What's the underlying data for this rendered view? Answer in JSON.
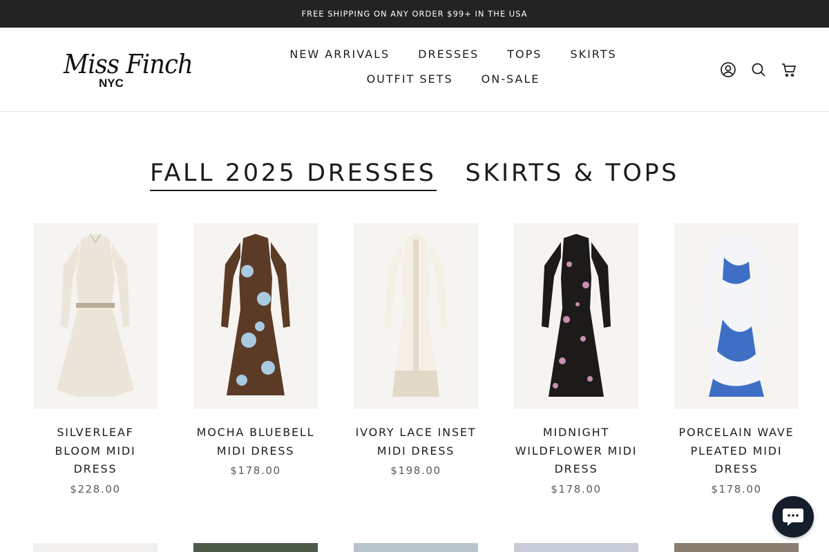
{
  "announcement": "FREE SHIPPING ON ANY ORDER $99+ IN THE USA",
  "brand": {
    "script": "Miss Finch",
    "sub": "NYC"
  },
  "nav": [
    "NEW ARRIVALS",
    "DRESSES",
    "TOPS",
    "SKIRTS",
    "OUTFIT SETS",
    "ON-SALE"
  ],
  "header_icons": [
    "account-icon",
    "search-icon",
    "cart-icon"
  ],
  "tabs": [
    {
      "label": "FALL 2025 DRESSES",
      "active": true
    },
    {
      "label": "SKIRTS & TOPS",
      "active": false
    }
  ],
  "products": [
    {
      "title": "SILVERLEAF BLOOM MIDI DRESS",
      "price": "$228.00",
      "colors": [
        "#ece5da",
        "#b7ab97"
      ]
    },
    {
      "title": "MOCHA BLUEBELL MIDI DRESS",
      "price": "$178.00",
      "colors": [
        "#5b3b26",
        "#a8cbe2"
      ]
    },
    {
      "title": "IVORY LACE INSET MIDI DRESS",
      "price": "$198.00",
      "colors": [
        "#f5f0e6",
        "#e2d9c8"
      ]
    },
    {
      "title": "MIDNIGHT WILDFLOWER MIDI DRESS",
      "price": "$178.00",
      "colors": [
        "#1d1b1a",
        "#c98fb2"
      ]
    },
    {
      "title": "PORCELAIN WAVE PLEATED MIDI DRESS",
      "price": "$178.00",
      "colors": [
        "#f3f5f8",
        "#3f6fc4"
      ]
    }
  ],
  "next_row_colors": [
    "#f2f0ee",
    "#4d5a48",
    "#b8c4cc",
    "#c7ccd8",
    "#8a7d70"
  ],
  "chat_icon": "chat-bubble-icon",
  "colors": {
    "announcement_bg": "#232323",
    "chat_bg": "#161d2b",
    "text": "#1c1c1c",
    "price": "#5a5a5a"
  }
}
